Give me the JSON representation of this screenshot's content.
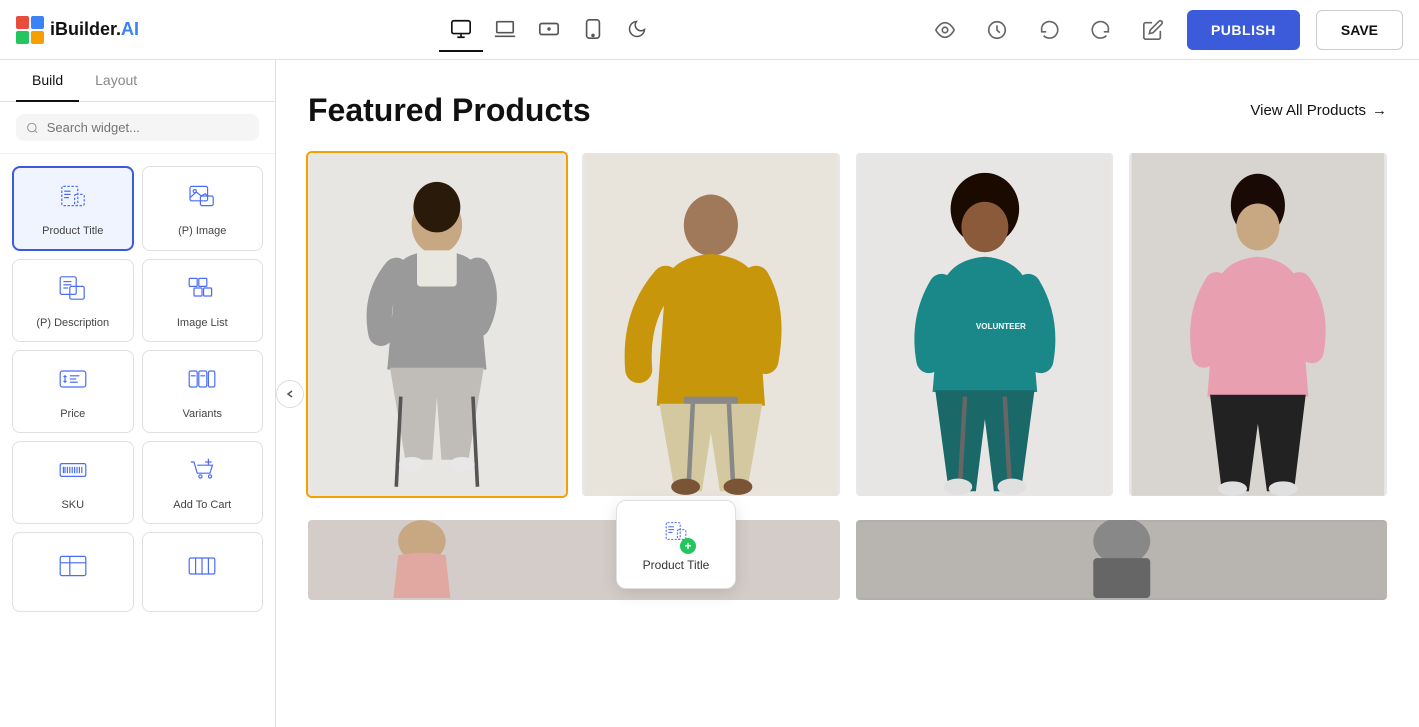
{
  "logo": {
    "text": "iBuilder.",
    "ai_text": "AI",
    "colors": [
      "#e74c3c",
      "#3b82f6",
      "#22c55e",
      "#f59f00"
    ]
  },
  "topnav": {
    "publish_label": "PUBLISH",
    "save_label": "SAVE"
  },
  "devices": [
    {
      "id": "desktop",
      "active": true
    },
    {
      "id": "laptop",
      "active": false
    },
    {
      "id": "tablet",
      "active": false
    },
    {
      "id": "mobile",
      "active": false
    },
    {
      "id": "dark",
      "active": false
    }
  ],
  "sidebar": {
    "build_tab": "Build",
    "layout_tab": "Layout",
    "search_placeholder": "Search widget...",
    "widgets": [
      {
        "id": "product-title",
        "label": "Product Title",
        "selected": true
      },
      {
        "id": "p-image",
        "label": "(P) Image"
      },
      {
        "id": "p-description",
        "label": "(P) Description"
      },
      {
        "id": "image-list",
        "label": "Image List"
      },
      {
        "id": "price",
        "label": "Price"
      },
      {
        "id": "variants",
        "label": "Variants"
      },
      {
        "id": "sku",
        "label": "SKU"
      },
      {
        "id": "add-to-cart",
        "label": "Add To Cart"
      },
      {
        "id": "extra1",
        "label": ""
      },
      {
        "id": "extra2",
        "label": ""
      }
    ]
  },
  "canvas": {
    "featured_title": "Featured Products",
    "view_all_label": "View All Products",
    "view_all_arrow": "→"
  },
  "drag_tooltip": {
    "label": "Product Title"
  }
}
